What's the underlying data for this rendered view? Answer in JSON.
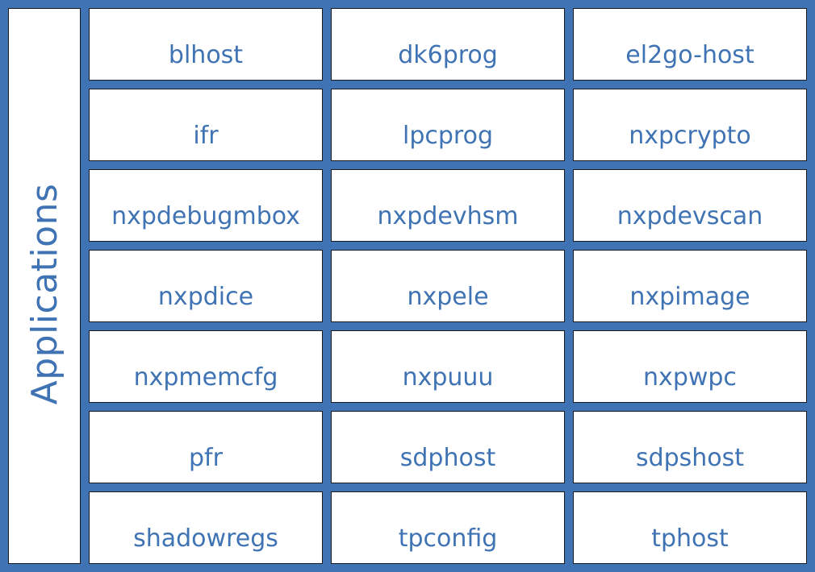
{
  "side_title": "Applications",
  "apps": [
    "blhost",
    "dk6prog",
    "el2go-host",
    "ifr",
    "lpcprog",
    "nxpcrypto",
    "nxpdebugmbox",
    "nxpdevhsm",
    "nxpdevscan",
    "nxpdice",
    "nxpele",
    "nxpimage",
    "nxpmemcfg",
    "nxpuuu",
    "nxpwpc",
    "pfr",
    "sdphost",
    "sdpshost",
    "shadowregs",
    "tpconfig",
    "tphost"
  ],
  "colors": {
    "background": "#3f73b3",
    "text": "#3f73b3",
    "box": "#ffffff",
    "border": "#1a1a1a"
  }
}
